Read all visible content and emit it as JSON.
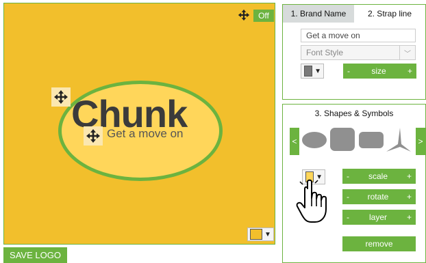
{
  "canvas": {
    "brand_name": "Chunk",
    "strap_line": "Get a move on",
    "toggle_label": "Off",
    "icons": {
      "move": "move-arrows-icon",
      "dropdown": "triangle-down-icon"
    },
    "colors": {
      "background": "#f2bf2c",
      "ellipse_fill": "#ffd65a",
      "ellipse_border": "#6cb33f",
      "text": "#3b3b3b",
      "swatch": "#f2bf2c"
    }
  },
  "save_button": "SAVE LOGO",
  "text_panel": {
    "tabs": [
      {
        "label": "1. Brand Name"
      },
      {
        "label": "2. Strap line"
      }
    ],
    "active_tab": "2. Strap line",
    "strap_input_value": "Get a move on",
    "font_style_placeholder": "Font Style",
    "text_color": "#7a7a7a",
    "size_control": {
      "minus": "-",
      "label": "size",
      "plus": "+"
    }
  },
  "shapes_panel": {
    "title": "3. Shapes & Symbols",
    "prev": "<",
    "next": ">",
    "shapes": [
      "ellipse",
      "rounded-square",
      "rounded-rectangle",
      "three-point-star"
    ],
    "shape_color": "#ffd65a",
    "controls": [
      {
        "minus": "-",
        "label": "scale",
        "plus": "+"
      },
      {
        "minus": "-",
        "label": "rotate",
        "plus": "+"
      },
      {
        "minus": "-",
        "label": "layer",
        "plus": "+"
      }
    ],
    "remove_label": "remove"
  },
  "accent_color": "#6cb33f",
  "cursor_icon": "hand-pointer-icon"
}
